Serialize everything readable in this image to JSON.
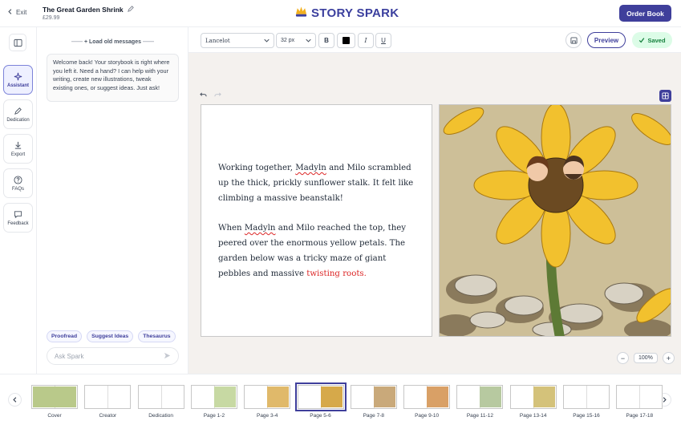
{
  "header": {
    "exit_label": "Exit",
    "book_title": "The Great Garden Shrink",
    "price": "£29.99",
    "logo_text": "STORY SPARK",
    "order_label": "Order Book"
  },
  "rail": {
    "items": [
      {
        "label": "Assistant",
        "icon": "sparkle-icon",
        "active": true
      },
      {
        "label": "Dedication",
        "icon": "pencil-icon"
      },
      {
        "label": "Export",
        "icon": "download-icon"
      },
      {
        "label": "FAQs",
        "icon": "question-icon"
      },
      {
        "label": "Feedback",
        "icon": "chat-icon"
      }
    ]
  },
  "chat": {
    "load_old": "+ Load old messages",
    "welcome": "Welcome back! Your storybook is right where you left it. Need a hand? I can help with your writing, create new illustrations, tweak existing ones, or suggest ideas. Just ask!",
    "chips": [
      "Proofread",
      "Suggest Ideas",
      "Thesaurus"
    ],
    "ask_placeholder": "Ask Spark"
  },
  "toolbar": {
    "font": "Lancelot",
    "size": "32 px",
    "bold": "B",
    "italic": "I",
    "underline": "U",
    "text_color": "#000000",
    "preview_label": "Preview",
    "saved_label": "Saved"
  },
  "story": {
    "p1_a": "Working together, ",
    "p1_name1": "Madyln",
    "p1_b": " and Milo scrambled up the thick, prickly sunflower stalk. It felt like climbing a massive beanstalk!",
    "p2_a": "When ",
    "p2_name1": "Madyln",
    "p2_b": " and Milo reached the top, they peered over the enormous yellow petals. The garden below was a tricky maze of giant pebbles and massive ",
    "p2_hl": "twisting roots."
  },
  "zoom": {
    "value": "100%",
    "minus": "−",
    "plus": "+"
  },
  "filmstrip": {
    "items": [
      {
        "label": "Cover"
      },
      {
        "label": "Creator"
      },
      {
        "label": "Dedication"
      },
      {
        "label": "Page 1-2"
      },
      {
        "label": "Page 3-4"
      },
      {
        "label": "Page 5-6",
        "active": true
      },
      {
        "label": "Page 7-8"
      },
      {
        "label": "Page 9-10"
      },
      {
        "label": "Page 11-12"
      },
      {
        "label": "Page 13-14"
      },
      {
        "label": "Page 15-16"
      },
      {
        "label": "Page 17-18"
      }
    ]
  }
}
